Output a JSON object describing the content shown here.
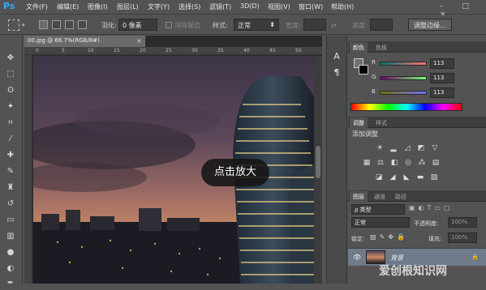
{
  "app": {
    "logo": "Ps",
    "accent": "#31a8ff"
  },
  "menu": [
    "文件(F)",
    "编辑(E)",
    "图像(I)",
    "图层(L)",
    "文字(Y)",
    "选择(S)",
    "滤镜(T)",
    "3D(D)",
    "视图(V)",
    "窗口(W)",
    "帮助(H)"
  ],
  "options": {
    "feather_label": "羽化:",
    "feather_value": "0 像素",
    "antialias_label": "消除锯齿",
    "style_label": "样式:",
    "style_value": "正常",
    "width_label": "宽度:",
    "height_label": "高度:",
    "refine_button": "调整边缘..."
  },
  "document": {
    "tab_title": "00.jpg @ 66.7%(RGB/8#)",
    "close_glyph": "×"
  },
  "ruler_top_ticks": [
    "0",
    "5",
    "10",
    "15",
    "20",
    "25",
    "30",
    "35",
    "40",
    "45",
    "50"
  ],
  "tooltip": "点击放大",
  "color_panel": {
    "tabs": [
      "颜色",
      "色板"
    ],
    "channels": [
      {
        "name": "R",
        "value": "113"
      },
      {
        "name": "G",
        "value": "113"
      },
      {
        "name": "B",
        "value": "113"
      }
    ]
  },
  "adjust_panel": {
    "tabs": [
      "调整",
      "样式"
    ],
    "title": "添加调整"
  },
  "layers_panel": {
    "tabs": [
      "图层",
      "通道",
      "路径"
    ],
    "kind_label": "ρ 类型",
    "blend_mode": "正常",
    "opacity_label": "不透明度:",
    "opacity_value": "100%",
    "lock_label": "锁定:",
    "fill_label": "填充:",
    "fill_value": "100%",
    "layer_name": "背景"
  },
  "watermark": "爱创根知识网"
}
